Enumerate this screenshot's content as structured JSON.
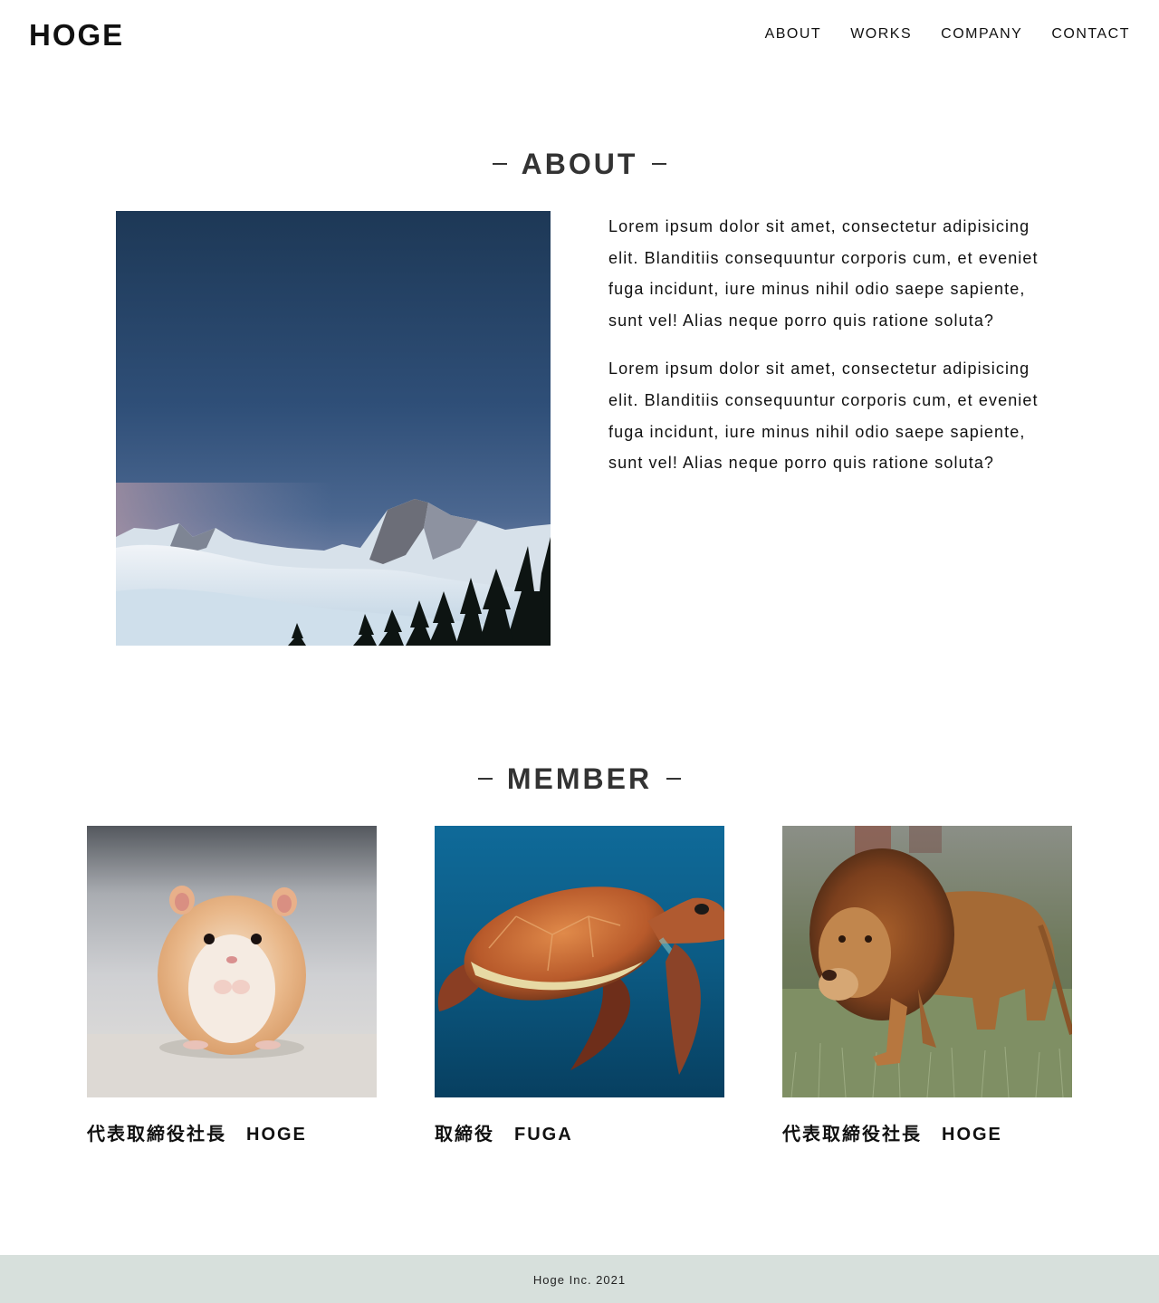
{
  "header": {
    "logo": "HOGE",
    "nav": [
      "ABOUT",
      "WORKS",
      "COMPANY",
      "CONTACT"
    ]
  },
  "about": {
    "title": "ABOUT",
    "image_icon": "mountain-landscape-photo",
    "paragraphs": [
      "Lorem ipsum dolor sit amet, consectetur adipisicing elit. Blanditiis consequuntur corporis cum, et eveniet fuga incidunt, iure minus nihil odio saepe sapiente, sunt vel! Alias neque porro quis ratione soluta?",
      "Lorem ipsum dolor sit amet, consectetur adipisicing elit. Blanditiis consequuntur corporis cum, et eveniet fuga incidunt, iure minus nihil odio saepe sapiente, sunt vel! Alias neque porro quis ratione soluta?"
    ]
  },
  "member": {
    "title": "MEMBER",
    "members": [
      {
        "name": "代表取締役社長　HOGE",
        "photo_icon": "hamster-photo"
      },
      {
        "name": "取締役　FUGA",
        "photo_icon": "sea-turtle-photo"
      },
      {
        "name": "代表取締役社長　HOGE",
        "photo_icon": "lion-photo"
      }
    ]
  },
  "footer": {
    "copyright": "Hoge Inc. 2021",
    "background_color": "#d7e0dc"
  }
}
